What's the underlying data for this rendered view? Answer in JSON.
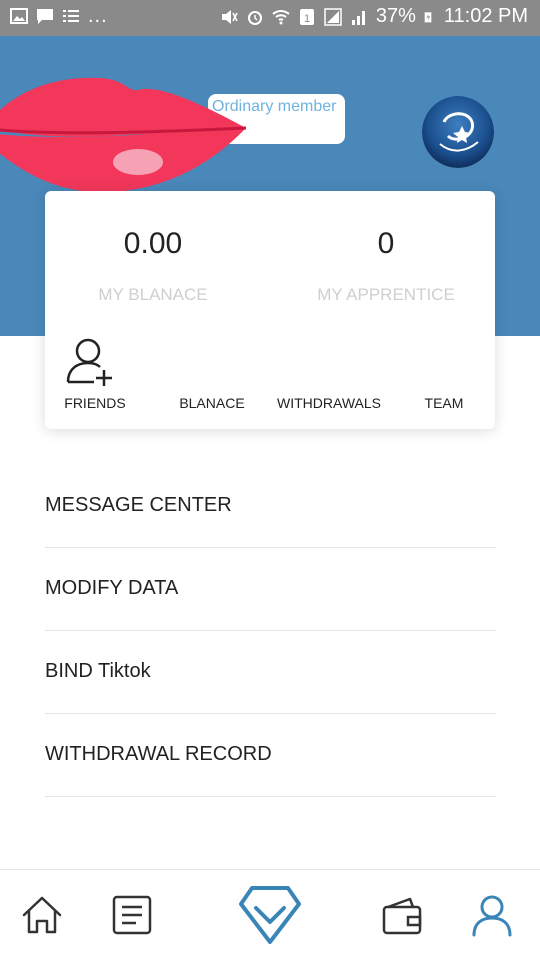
{
  "status_bar": {
    "left_dots": "...",
    "battery": "37%",
    "time": "11:02 PM"
  },
  "header": {
    "member_label": "Ordinary member"
  },
  "stats": {
    "balance_value": "0.00",
    "balance_label": "MY BLANACE",
    "apprentice_value": "0",
    "apprentice_label": "MY APPRENTICE"
  },
  "quick_actions": [
    {
      "label": "FRIENDS",
      "icon": "add-friend-icon"
    },
    {
      "label": "BLANACE",
      "icon": ""
    },
    {
      "label": "WITHDRAWALS",
      "icon": ""
    },
    {
      "label": "TEAM",
      "icon": ""
    }
  ],
  "menu": [
    {
      "label": "MESSAGE CENTER"
    },
    {
      "label": "MODIFY DATA"
    },
    {
      "label": "BIND Tiktok"
    },
    {
      "label": "WITHDRAWAL RECORD"
    }
  ],
  "bottom_nav": [
    {
      "icon": "home-icon"
    },
    {
      "icon": "task-list-icon"
    },
    {
      "icon": "diamond-check-icon"
    },
    {
      "icon": "wallet-icon"
    },
    {
      "icon": "profile-icon",
      "active": true
    }
  ],
  "colors": {
    "header_bg": "#4a88ba",
    "accent": "#3a85b8",
    "status_bar_bg": "#8a8a8a",
    "lips": "#f23a5c"
  }
}
